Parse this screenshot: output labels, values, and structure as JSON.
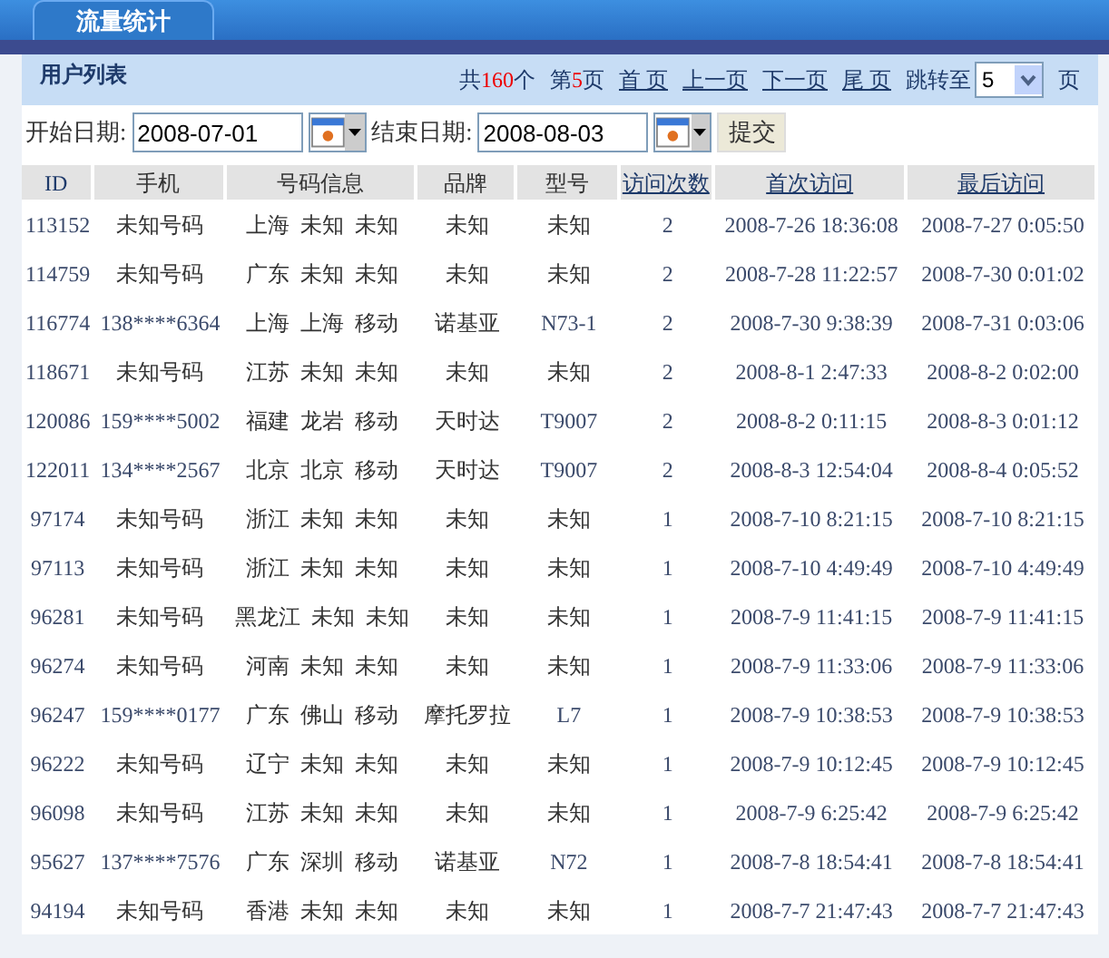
{
  "tabs": [
    {
      "label": "流量统计",
      "selected": true
    }
  ],
  "panel": {
    "title": "用户列表",
    "pager": {
      "total_prefix": "共",
      "total": "160",
      "total_suffix": "个",
      "page_prefix": "第",
      "page": "5",
      "page_suffix": "页",
      "links": [
        "首 页",
        "上一页",
        "下一页",
        "尾 页"
      ],
      "jump_label": "跳转至",
      "jump_value": "5",
      "jump_suffix": "页"
    }
  },
  "filter": {
    "start_label": "开始日期:",
    "start_value": "2008-07-01",
    "end_label": "结束日期:",
    "end_value": "2008-08-03",
    "submit": "提交"
  },
  "table": {
    "columns": [
      {
        "label": "ID",
        "sortable": false
      },
      {
        "label": "手机",
        "sortable": false
      },
      {
        "label": "号码信息",
        "sortable": false
      },
      {
        "label": "品牌",
        "sortable": false
      },
      {
        "label": "型号",
        "sortable": false
      },
      {
        "label": "访问次数",
        "sortable": true
      },
      {
        "label": "首次访问",
        "sortable": true
      },
      {
        "label": "最后访问",
        "sortable": true
      }
    ],
    "rows": [
      {
        "id": "113152",
        "phone": "未知号码",
        "info": [
          "上海",
          "未知",
          "未知"
        ],
        "brand": "未知",
        "model": "未知",
        "visits": "2",
        "first": "2008-7-26 18:36:08",
        "last": "2008-7-27 0:05:50"
      },
      {
        "id": "114759",
        "phone": "未知号码",
        "info": [
          "广东",
          "未知",
          "未知"
        ],
        "brand": "未知",
        "model": "未知",
        "visits": "2",
        "first": "2008-7-28 11:22:57",
        "last": "2008-7-30 0:01:02"
      },
      {
        "id": "116774",
        "phone": "138****6364",
        "info": [
          "上海",
          "上海",
          "移动"
        ],
        "brand": "诺基亚",
        "model": "N73-1",
        "visits": "2",
        "first": "2008-7-30 9:38:39",
        "last": "2008-7-31 0:03:06"
      },
      {
        "id": "118671",
        "phone": "未知号码",
        "info": [
          "江苏",
          "未知",
          "未知"
        ],
        "brand": "未知",
        "model": "未知",
        "visits": "2",
        "first": "2008-8-1 2:47:33",
        "last": "2008-8-2 0:02:00"
      },
      {
        "id": "120086",
        "phone": "159****5002",
        "info": [
          "福建",
          "龙岩",
          "移动"
        ],
        "brand": "天时达",
        "model": "T9007",
        "visits": "2",
        "first": "2008-8-2 0:11:15",
        "last": "2008-8-3 0:01:12"
      },
      {
        "id": "122011",
        "phone": "134****2567",
        "info": [
          "北京",
          "北京",
          "移动"
        ],
        "brand": "天时达",
        "model": "T9007",
        "visits": "2",
        "first": "2008-8-3 12:54:04",
        "last": "2008-8-4 0:05:52"
      },
      {
        "id": "97174",
        "phone": "未知号码",
        "info": [
          "浙江",
          "未知",
          "未知"
        ],
        "brand": "未知",
        "model": "未知",
        "visits": "1",
        "first": "2008-7-10 8:21:15",
        "last": "2008-7-10 8:21:15"
      },
      {
        "id": "97113",
        "phone": "未知号码",
        "info": [
          "浙江",
          "未知",
          "未知"
        ],
        "brand": "未知",
        "model": "未知",
        "visits": "1",
        "first": "2008-7-10 4:49:49",
        "last": "2008-7-10 4:49:49"
      },
      {
        "id": "96281",
        "phone": "未知号码",
        "info": [
          "黑龙江",
          "未知",
          "未知"
        ],
        "brand": "未知",
        "model": "未知",
        "visits": "1",
        "first": "2008-7-9 11:41:15",
        "last": "2008-7-9 11:41:15"
      },
      {
        "id": "96274",
        "phone": "未知号码",
        "info": [
          "河南",
          "未知",
          "未知"
        ],
        "brand": "未知",
        "model": "未知",
        "visits": "1",
        "first": "2008-7-9 11:33:06",
        "last": "2008-7-9 11:33:06"
      },
      {
        "id": "96247",
        "phone": "159****0177",
        "info": [
          "广东",
          "佛山",
          "移动"
        ],
        "brand": "摩托罗拉",
        "model": "L7",
        "visits": "1",
        "first": "2008-7-9 10:38:53",
        "last": "2008-7-9 10:38:53"
      },
      {
        "id": "96222",
        "phone": "未知号码",
        "info": [
          "辽宁",
          "未知",
          "未知"
        ],
        "brand": "未知",
        "model": "未知",
        "visits": "1",
        "first": "2008-7-9 10:12:45",
        "last": "2008-7-9 10:12:45"
      },
      {
        "id": "96098",
        "phone": "未知号码",
        "info": [
          "江苏",
          "未知",
          "未知"
        ],
        "brand": "未知",
        "model": "未知",
        "visits": "1",
        "first": "2008-7-9 6:25:42",
        "last": "2008-7-9 6:25:42"
      },
      {
        "id": "95627",
        "phone": "137****7576",
        "info": [
          "广东",
          "深圳",
          "移动"
        ],
        "brand": "诺基亚",
        "model": "N72",
        "visits": "1",
        "first": "2008-7-8 18:54:41",
        "last": "2008-7-8 18:54:41"
      },
      {
        "id": "94194",
        "phone": "未知号码",
        "info": [
          "香港",
          "未知",
          "未知"
        ],
        "brand": "未知",
        "model": "未知",
        "visits": "1",
        "first": "2008-7-7 21:47:43",
        "last": "2008-7-7 21:47:43"
      }
    ]
  }
}
